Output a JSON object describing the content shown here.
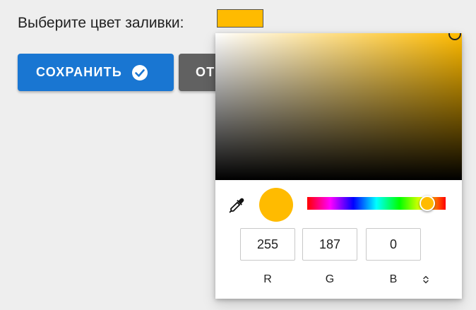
{
  "form": {
    "fill_label": "Выберите цвет заливки:",
    "current_color": "#ffbb00"
  },
  "buttons": {
    "save_label": "СОХРАНИТЬ",
    "cancel_label": "ОТ"
  },
  "picker": {
    "red": "255",
    "green": "187",
    "blue": "0",
    "label_r": "R",
    "label_g": "G",
    "label_b": "B",
    "mode": "RGB"
  },
  "icons": {
    "save": "check-circle-icon",
    "eyedropper": "eyedropper-icon",
    "mode_toggle": "up-down-arrows-icon"
  },
  "colors": {
    "primary": "#1976d2",
    "secondary": "#616161",
    "selected": "#ffbb00"
  }
}
